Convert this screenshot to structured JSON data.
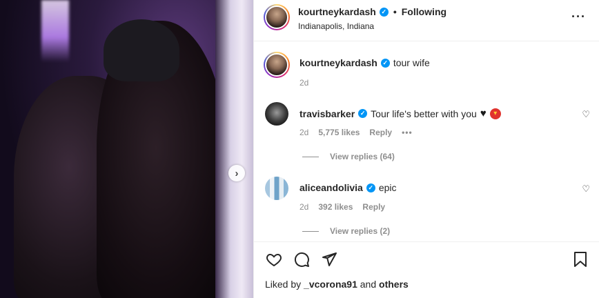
{
  "header": {
    "username": "kourtneykardash",
    "separator": "•",
    "follow_state": "Following",
    "location": "Indianapolis, Indiana",
    "more_icon": "more-horizontal-icon"
  },
  "caption": {
    "username": "kourtneykardash",
    "text": "tour wife",
    "time": "2d"
  },
  "comments": [
    {
      "username": "travisbarker",
      "text": "Tour life's better with you",
      "time": "2d",
      "likes": "5,775 likes",
      "reply_label": "Reply",
      "more": "•••",
      "view_replies": "View replies (64)"
    },
    {
      "username": "aliceandolivia",
      "text": "epic",
      "time": "2d",
      "likes": "392 likes",
      "reply_label": "Reply",
      "view_replies": "View replies (2)"
    }
  ],
  "actions": {
    "like_icon": "heart-icon",
    "comment_icon": "comment-icon",
    "share_icon": "share-icon",
    "save_icon": "bookmark-icon"
  },
  "liked_by": {
    "prefix": "Liked by ",
    "user": "_vcorona91",
    "middle": " and ",
    "others": "others"
  },
  "colors": {
    "verified": "#0095f6",
    "muted": "#8e8e8e",
    "text": "#262626"
  }
}
